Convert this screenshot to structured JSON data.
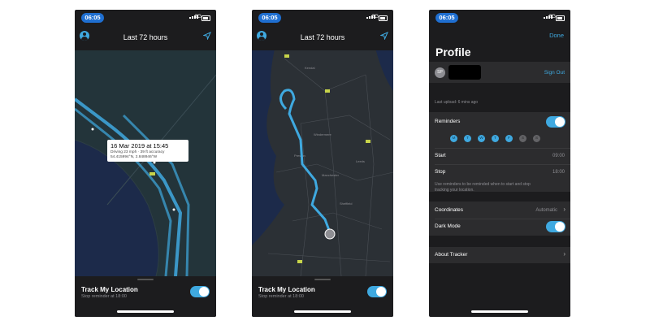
{
  "status_time_1": "06:05",
  "status_time_2": "06:05",
  "status_time_3": "06:05",
  "network": "3G",
  "map_header": {
    "title": "Last 72 hours"
  },
  "bottom_panel": {
    "title": "Track My Location",
    "subtitle": "Stop reminder at 18:00"
  },
  "tooltip": {
    "title": "16 Mar 2019 at 15:45",
    "detail": "Driving 23 mph · 39 ft accuracy",
    "coords": "54.415994°N, 2.848946°W"
  },
  "profile": {
    "done": "Done",
    "title": "Profile",
    "avatar_initials": "SP",
    "sign_out": "Sign Out",
    "last_upload": "Last upload: 6 mins ago",
    "reminders": "Reminders",
    "days": [
      {
        "letter": "M",
        "on": true
      },
      {
        "letter": "T",
        "on": true
      },
      {
        "letter": "W",
        "on": true
      },
      {
        "letter": "T",
        "on": true
      },
      {
        "letter": "F",
        "on": true
      },
      {
        "letter": "S",
        "on": false
      },
      {
        "letter": "S",
        "on": false
      }
    ],
    "start_label": "Start",
    "start_value": "09:00",
    "stop_label": "Stop",
    "stop_value": "18:00",
    "reminder_note_1": "Use reminders to be reminded when to start and stop",
    "reminder_note_2": "tracking your location.",
    "coordinates_label": "Coordinates",
    "coordinates_value": "Automatic",
    "dark_mode_label": "Dark Mode",
    "about_label": "About Tracker"
  },
  "map_places": [
    "Kendal",
    "Windermere",
    "Preston",
    "Manchester",
    "Leeds",
    "Sheffield"
  ],
  "colors": {
    "accent": "#3fa9e0",
    "background": "#1c1c1e",
    "row": "#2c2c2e"
  }
}
